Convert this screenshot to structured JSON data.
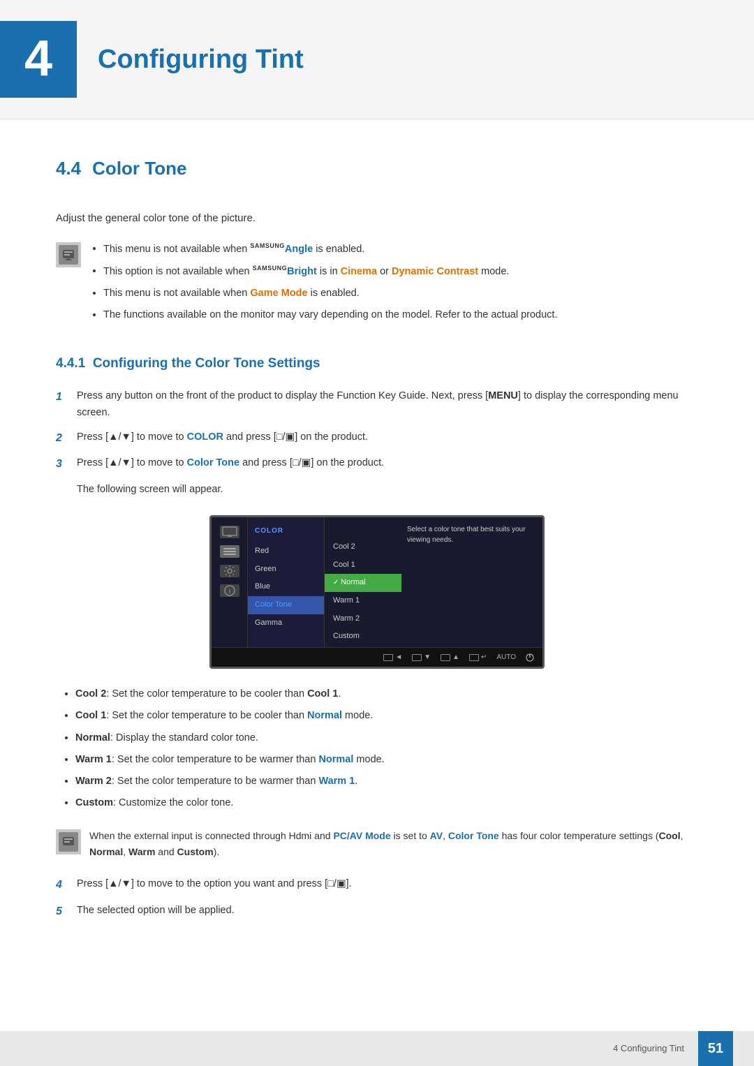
{
  "chapter": {
    "number": "4",
    "title": "Configuring Tint"
  },
  "section": {
    "number": "4.4",
    "title": "Color Tone",
    "description": "Adjust the general color tone of the picture."
  },
  "notes": [
    "This menu is not available when SAMSUNGAngle is enabled.",
    "This option is not available when SAMSUNGBright is in Cinema or Dynamic Contrast mode.",
    "This menu is not available when Game Mode is enabled.",
    "The functions available on the monitor may vary depending on the model. Refer to the actual product."
  ],
  "subsection": {
    "number": "4.4.1",
    "title": "Configuring the Color Tone Settings"
  },
  "steps": [
    {
      "num": "1",
      "text": "Press any button on the front of the product to display the Function Key Guide. Next, press [MENU] to display the corresponding menu screen."
    },
    {
      "num": "2",
      "text": "Press [▲/▼] to move to COLOR and press [□/▣] on the product."
    },
    {
      "num": "3",
      "text": "Press [▲/▼] to move to Color Tone and press [□/▣] on the product."
    }
  ],
  "screen_appears": "The following screen will appear.",
  "monitor": {
    "menu_label": "COLOR",
    "menu_items": [
      "Red",
      "Green",
      "Blue",
      "Color Tone",
      "Gamma"
    ],
    "selected_menu": "Color Tone",
    "submenu_items": [
      "Cool 2",
      "Cool 1",
      "Normal",
      "Warm 1",
      "Warm 2",
      "Custom"
    ],
    "selected_submenu": "Normal",
    "info_text": "Select a color tone that best suits your viewing needs.",
    "bottom_buttons": [
      "◄",
      "▼",
      "▲",
      "↵",
      "AUTO",
      "Ø"
    ]
  },
  "bullet_items": [
    {
      "term": "Cool 2",
      "colon": ": Set the color temperature to be cooler than ",
      "ref": "Cool 1",
      "end": "."
    },
    {
      "term": "Cool 1",
      "colon": ": Set the color temperature to be cooler than ",
      "ref": "Normal",
      "refclass": "blue",
      "end": " mode."
    },
    {
      "term": "Normal",
      "colon": ": Display the standard color tone.",
      "ref": "",
      "end": ""
    },
    {
      "term": "Warm 1",
      "colon": ": Set the color temperature to be warmer than ",
      "ref": "Normal",
      "refclass": "blue",
      "end": " mode."
    },
    {
      "term": "Warm 2",
      "colon": ": Set the color temperature to be warmer than ",
      "ref": "Warm 1",
      "refclass": "blue",
      "end": "."
    },
    {
      "term": "Custom",
      "colon": ": Customize the color tone.",
      "ref": "",
      "end": ""
    }
  ],
  "inline_note_text": "When the external input is connected through Hdmi and PC/AV Mode is set to AV, Color Tone has four color temperature settings (Cool, Normal, Warm and Custom).",
  "steps_continued": [
    {
      "num": "4",
      "text": "Press [▲/▼] to move to the option you want and press [□/▣]."
    },
    {
      "num": "5",
      "text": "The selected option will be applied."
    }
  ],
  "footer": {
    "text": "4 Configuring Tint",
    "page": "51"
  }
}
